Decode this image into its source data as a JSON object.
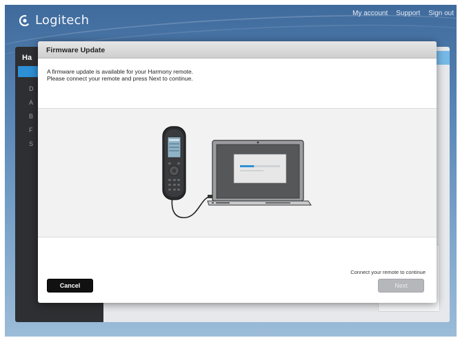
{
  "header": {
    "brand": "Logitech",
    "links": [
      "My account",
      "Support",
      "Sign out"
    ]
  },
  "background": {
    "sidebar_title": "Ha",
    "sidebar_items": [
      "D",
      "A",
      "B",
      "F",
      "S"
    ]
  },
  "dialog": {
    "title": "Firmware Update",
    "message_line1": "A firmware update is available for your Harmony remote.",
    "message_line2": "Please connect your remote and press Next to continue.",
    "status": "Connect your remote to continue",
    "cancel_label": "Cancel",
    "next_label": "Next",
    "next_enabled": false,
    "progress_fraction": 0.35
  },
  "icons": [
    "logitech-logo-icon",
    "harmony-remote-icon",
    "laptop-icon",
    "usb-cable-icon"
  ],
  "colors": {
    "accent": "#2d8fd6",
    "cancel_button": "#111111",
    "next_button_disabled": "#b5b7ba"
  }
}
